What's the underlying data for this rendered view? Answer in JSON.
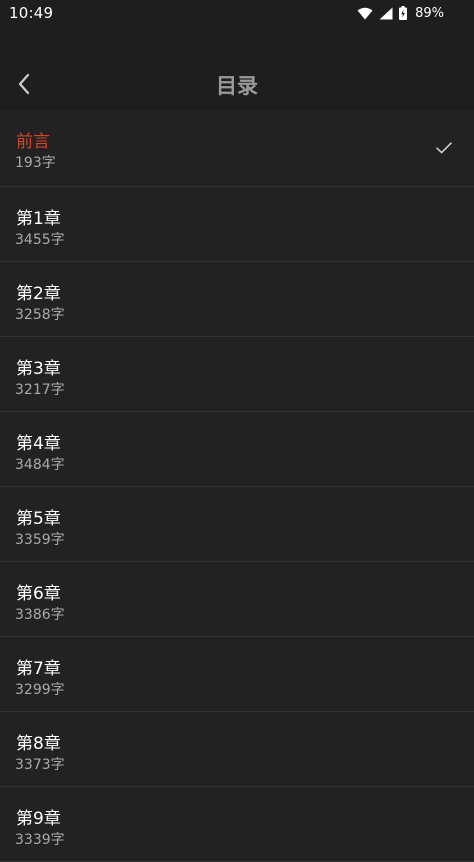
{
  "status_bar": {
    "time": "10:49",
    "battery": "89%",
    "icons": [
      "wifi-icon",
      "signal-icon",
      "battery-charging-icon"
    ]
  },
  "header": {
    "title": "目录",
    "back_icon": "back-chevron-icon"
  },
  "colors": {
    "background": "#222222",
    "header_background": "#1e1e20",
    "active_text": "#d4462c",
    "secondary_text": "#a9a9a9",
    "divider": "#333333"
  },
  "toc": {
    "items": [
      {
        "title": "前言",
        "count": "193字",
        "active": true
      },
      {
        "title": "第1章",
        "count": "3455字",
        "active": false
      },
      {
        "title": "第2章",
        "count": "3258字",
        "active": false
      },
      {
        "title": "第3章",
        "count": "3217字",
        "active": false
      },
      {
        "title": "第4章",
        "count": "3484字",
        "active": false
      },
      {
        "title": "第5章",
        "count": "3359字",
        "active": false
      },
      {
        "title": "第6章",
        "count": "3386字",
        "active": false
      },
      {
        "title": "第7章",
        "count": "3299字",
        "active": false
      },
      {
        "title": "第8章",
        "count": "3373字",
        "active": false
      },
      {
        "title": "第9章",
        "count": "3339字",
        "active": false
      }
    ]
  }
}
